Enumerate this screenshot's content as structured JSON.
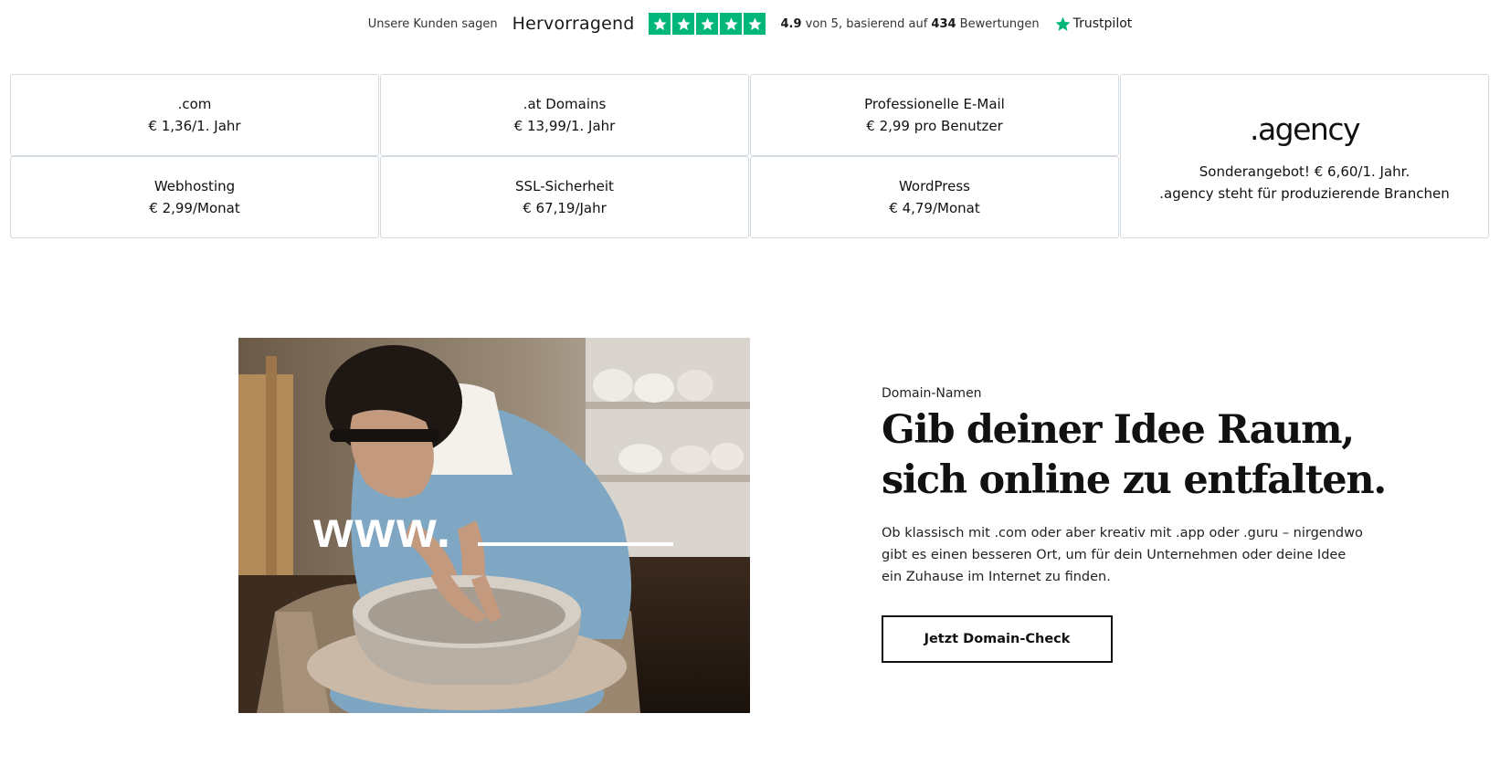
{
  "trustpilot": {
    "intro": "Unsere Kunden sagen",
    "rating_word": "Hervorragend",
    "stars": 5,
    "score_prefix": "4.9",
    "score_middle": " von 5, basierend auf ",
    "review_count": "434",
    "review_suffix": " Bewertungen",
    "brand": "Trustpilot",
    "star_color": "#00b67a"
  },
  "products": [
    {
      "title": ".com",
      "price": "€ 1,36/1. Jahr"
    },
    {
      "title": ".at Domains",
      "price": "€ 13,99/1. Jahr"
    },
    {
      "title": "Professionelle E-Mail",
      "price": "€ 2,99 pro Benutzer"
    },
    {
      "title": "Webhosting",
      "price": "€ 2,99/Monat"
    },
    {
      "title": "SSL-Sicherheit",
      "price": "€ 67,19/Jahr"
    },
    {
      "title": "WordPress",
      "price": "€ 4,79/Monat"
    }
  ],
  "featured": {
    "logo": ".agency",
    "line1": "Sonderangebot! € 6,60/1. Jahr.",
    "line2": ".agency steht für produzierende Branchen"
  },
  "domain_section": {
    "image_overlay": "www.",
    "eyebrow": "Domain-Namen",
    "headline_line1": "Gib deiner Idee Raum,",
    "headline_line2": "sich online zu entfalten.",
    "body": "Ob klassisch mit .com oder aber kreativ mit .app oder .guru – nirgendwo gibt es einen besseren Ort, um für dein Unternehmen oder deine Idee ein Zuhause im Internet zu finden.",
    "cta_label": "Jetzt Domain-Check"
  }
}
